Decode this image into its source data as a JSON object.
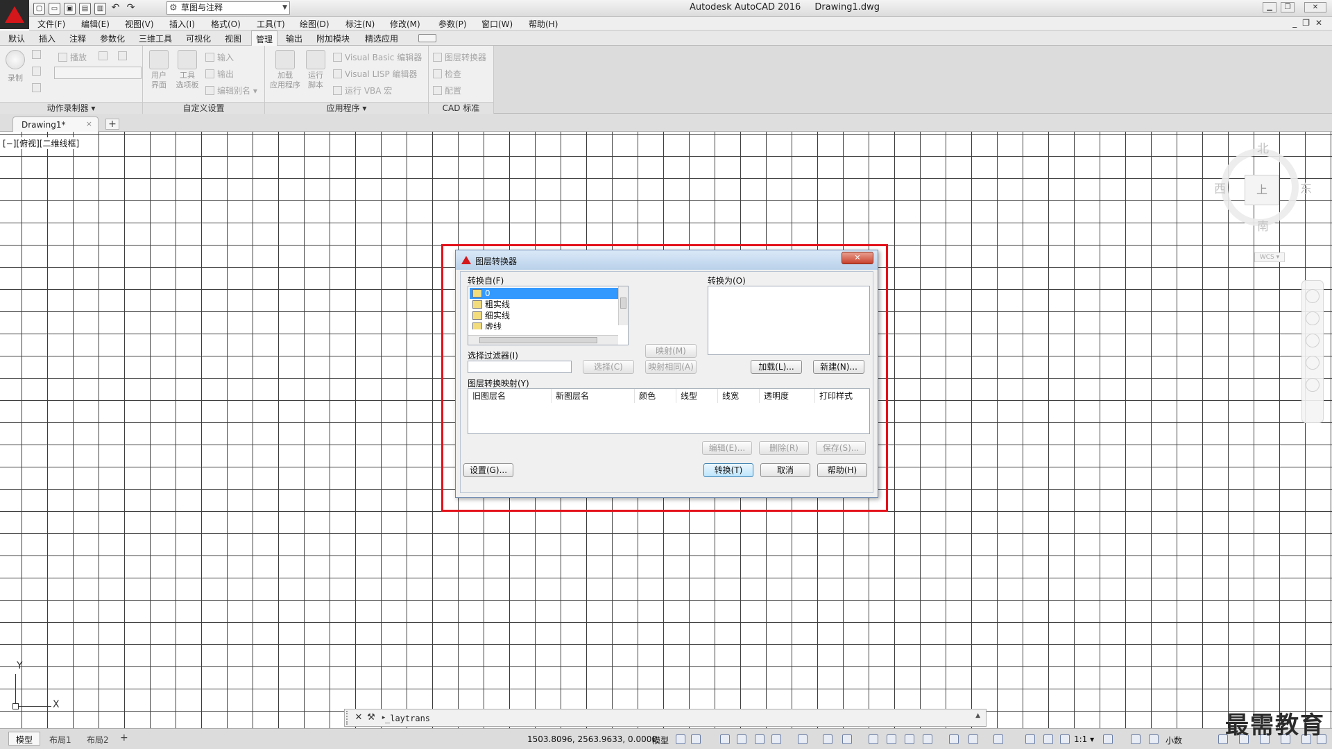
{
  "titlebar": {
    "app_title": "Autodesk AutoCAD 2016",
    "file_name": "Drawing1.dwg",
    "workspace": "草图与注释",
    "qat_icons": [
      "new-icon",
      "open-icon",
      "save-icon",
      "saveas-icon",
      "plot-icon",
      "undo-icon",
      "redo-icon"
    ]
  },
  "menubar": {
    "items": [
      "文件(F)",
      "编辑(E)",
      "视图(V)",
      "插入(I)",
      "格式(O)",
      "工具(T)",
      "绘图(D)",
      "标注(N)",
      "修改(M)",
      "参数(P)",
      "窗口(W)",
      "帮助(H)"
    ]
  },
  "ribbon_tabs": [
    "默认",
    "插入",
    "注释",
    "参数化",
    "三维工具",
    "可视化",
    "视图",
    "管理",
    "输出",
    "附加模块",
    "精选应用"
  ],
  "ribbon": {
    "action_recorder": {
      "record": "录制",
      "play": "播放",
      "title": "动作录制器 ▾"
    },
    "customization": {
      "cui_line1": "用户",
      "cui_line2": "界面",
      "tool_line1": "工具",
      "tool_line2": "选项板",
      "import": "输入",
      "export": "输出",
      "edit_aliases": "编辑别名 ▾",
      "title": "自定义设置"
    },
    "applications": {
      "load_line1": "加载",
      "load_line2": "应用程序",
      "run_line1": "运行",
      "run_line2": "脚本",
      "vb_editor": "Visual Basic 编辑器",
      "lisp_editor": "Visual LISP 编辑器",
      "run_vba": "运行 VBA 宏",
      "title": "应用程序 ▾"
    },
    "cad_standards": {
      "layer_translator": "图层转换器",
      "check": "检查",
      "configure": "配置",
      "title": "CAD 标准"
    }
  },
  "file_tab": {
    "name": "Drawing1*",
    "close": "×",
    "new": "+"
  },
  "viewport": {
    "label": "[−][俯视][二维线框]",
    "viewcube": {
      "north": "北",
      "south": "南",
      "east": "东",
      "west": "西",
      "top_face": "上"
    },
    "wcs": "WCS ▾",
    "ucs_x": "X",
    "ucs_y": "Y"
  },
  "dialog": {
    "title": "图层转换器",
    "close": "✕",
    "translate_from_label": "转换自(F)",
    "from_layers": [
      "0",
      "粗实线",
      "细实线",
      "虚线"
    ],
    "translate_to_label": "转换为(O)",
    "map_button": "映射(M)",
    "map_same_button": "映射相同(A)",
    "selection_filter_label": "选择过滤器(I)",
    "select_button": "选择(C)",
    "load_button": "加载(L)...",
    "new_button": "新建(N)...",
    "mappings_label": "图层转换映射(Y)",
    "columns": [
      "旧图层名",
      "新图层名",
      "颜色",
      "线型",
      "线宽",
      "透明度",
      "打印样式"
    ],
    "edit_button": "编辑(E)...",
    "remove_button": "删除(R)",
    "save_button": "保存(S)...",
    "settings_button": "设置(G)...",
    "translate_button": "转换(T)",
    "cancel_button": "取消",
    "help_button": "帮助(H)"
  },
  "command_line": {
    "text": "_laytrans"
  },
  "statusbar": {
    "layouts": [
      "模型",
      "布局1",
      "布局2"
    ],
    "add": "+",
    "coordinates": "1503.8096, 2563.9633, 0.0000",
    "model": "模型",
    "scale": "1:1 ▾",
    "units": "小数"
  },
  "watermark": "最需教育",
  "colors": {
    "highlight": "#e3121b",
    "selection": "#3399ff",
    "autocad_red": "#d4171a"
  }
}
